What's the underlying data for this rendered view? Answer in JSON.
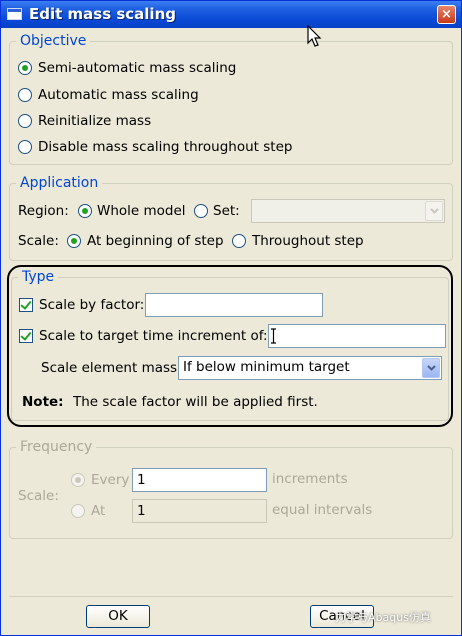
{
  "window": {
    "title": "Edit mass scaling",
    "close_glyph": "×"
  },
  "objective": {
    "legend": "Objective",
    "options": [
      {
        "label": "Semi-automatic mass scaling",
        "checked": true
      },
      {
        "label": "Automatic mass scaling",
        "checked": false
      },
      {
        "label": "Reinitialize mass",
        "checked": false
      },
      {
        "label": "Disable mass scaling throughout step",
        "checked": false
      }
    ]
  },
  "application": {
    "legend": "Application",
    "region_label": "Region:",
    "region_options": [
      {
        "label": "Whole model",
        "checked": true
      },
      {
        "label": "Set:",
        "checked": false
      }
    ],
    "set_value": "",
    "scale_label": "Scale:",
    "scale_options": [
      {
        "label": "At beginning of step",
        "checked": true
      },
      {
        "label": "Throughout step",
        "checked": false
      }
    ]
  },
  "type": {
    "legend": "Type",
    "scale_by_factor_label": "Scale by factor:",
    "scale_by_factor_checked": true,
    "scale_by_factor_value": "",
    "scale_to_target_label": "Scale to target time increment of:",
    "scale_to_target_checked": true,
    "scale_to_target_value": "",
    "element_mass_label": "Scale element mass:",
    "element_mass_value": "If below minimum target",
    "note_label": "Note:",
    "note_text": "The scale factor will be applied first."
  },
  "frequency": {
    "legend": "Frequency",
    "scale_label": "Scale:",
    "every_label": "Every",
    "every_value": "1",
    "every_checked": true,
    "every_suffix": "increments",
    "at_label": "At",
    "at_value": "1",
    "at_checked": false,
    "at_suffix": "equal intervals"
  },
  "buttons": {
    "ok": "OK",
    "cancel": "Cancel"
  },
  "watermark": "力学与Abaqus仿真",
  "colors": {
    "title_bar": "#0a49d6",
    "legend_text": "#0046d5",
    "check_mark": "#21a121",
    "disabled_text": "#aca899"
  }
}
